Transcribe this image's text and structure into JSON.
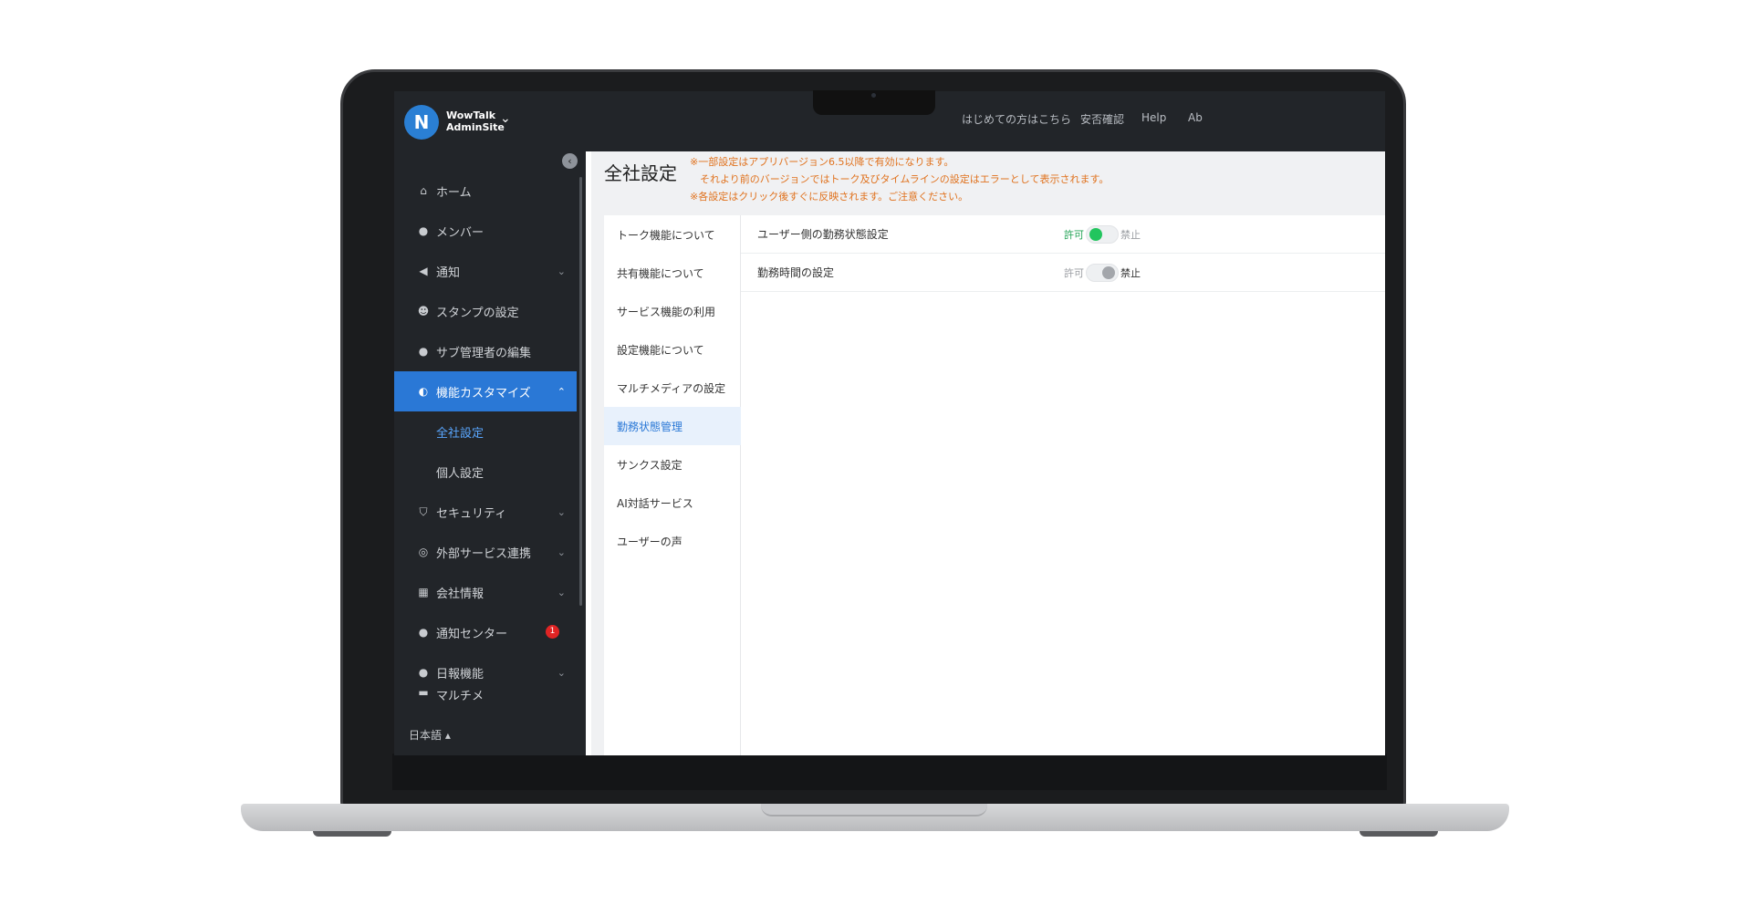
{
  "app": {
    "logo_line1": "WowTalk",
    "logo_line2": "AdminSite",
    "logo_mark": "N"
  },
  "topnav": [
    {
      "label": "はじめての方はこちら"
    },
    {
      "label": "安否確認"
    },
    {
      "label": "Help"
    },
    {
      "label": "Ab"
    }
  ],
  "sidebar": {
    "items": [
      {
        "label": "ホーム",
        "icon": "home-icon"
      },
      {
        "label": "メンバー",
        "icon": "user-icon"
      },
      {
        "label": "通知",
        "icon": "megaphone-icon"
      },
      {
        "label": "スタンプの設定",
        "icon": "smile-icon"
      },
      {
        "label": "サブ管理者の編集",
        "icon": "admin-user-icon"
      },
      {
        "label": "機能カスタマイズ",
        "icon": "toggle-icon"
      },
      {
        "label": "セキュリティ",
        "icon": "shield-icon"
      },
      {
        "label": "外部サービス連携",
        "icon": "link-icon"
      },
      {
        "label": "会社情報",
        "icon": "building-icon"
      },
      {
        "label": "通知センター",
        "icon": "notification-center-icon"
      },
      {
        "label": "日報機能",
        "icon": "report-icon"
      },
      {
        "label": "マルチメ",
        "icon": "media-icon"
      }
    ],
    "sub_items": [
      {
        "label": "全社設定"
      },
      {
        "label": "個人設定"
      }
    ],
    "notification_badge": "1",
    "language": "日本語"
  },
  "page": {
    "title": "全社設定",
    "notice": "※一部設定はアプリバージョン6.5以降で有効になります。\n　それより前のバージョンではトーク及びタイムラインの設定はエラーとして表示されます。\n※各設定はクリック後すぐに反映されます。ご注意ください。"
  },
  "subnav": [
    {
      "label": "トーク機能について"
    },
    {
      "label": "共有機能について"
    },
    {
      "label": "サービス機能の利用"
    },
    {
      "label": "設定機能について"
    },
    {
      "label": "マルチメディアの設定"
    },
    {
      "label": "勤務状態管理"
    },
    {
      "label": "サンクス設定"
    },
    {
      "label": "AI対話サービス"
    },
    {
      "label": "ユーザーの声"
    }
  ],
  "settings": [
    {
      "label": "ユーザー側の勤務状態設定",
      "allow": "許可",
      "deny": "禁止",
      "enabled": true
    },
    {
      "label": "勤務時間の設定",
      "allow": "許可",
      "deny": "禁止",
      "enabled": false
    }
  ],
  "colors": {
    "accent": "#2a78d6",
    "toggle_on": "#22c55e",
    "toggle_off": "#a3a6ab",
    "notice": "#e0721e",
    "badge": "#e02424"
  }
}
